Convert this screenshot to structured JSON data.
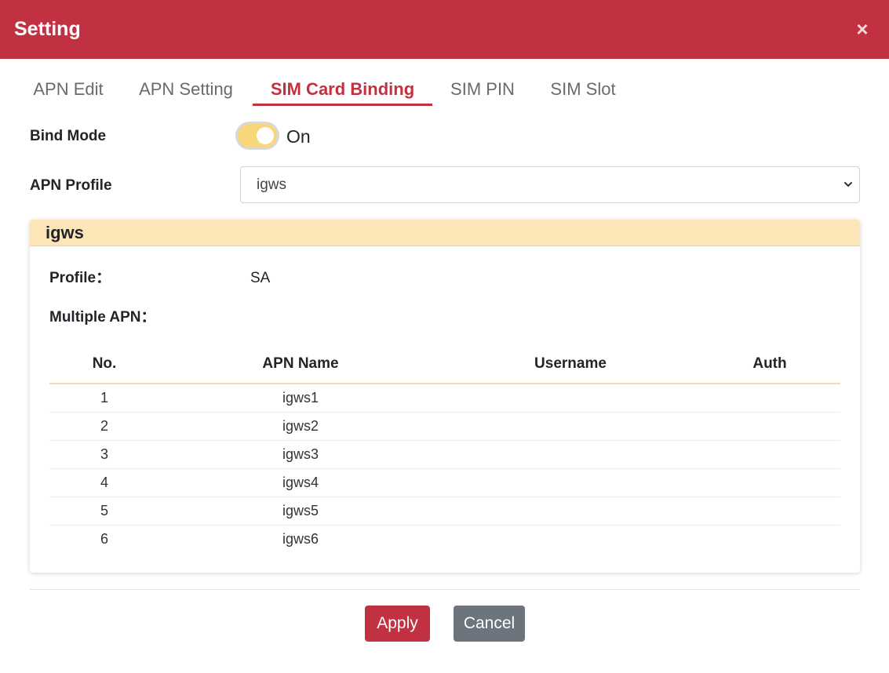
{
  "dialog": {
    "title": "Setting",
    "close_glyph": "×",
    "close_icon": "close-icon"
  },
  "tabs": [
    {
      "label": "APN Edit",
      "active": false
    },
    {
      "label": "APN Setting",
      "active": false
    },
    {
      "label": "SIM Card Binding",
      "active": true
    },
    {
      "label": "SIM PIN",
      "active": false
    },
    {
      "label": "SIM Slot",
      "active": false
    }
  ],
  "form": {
    "bind_mode_label": "Bind Mode",
    "bind_mode_state": "On",
    "bind_mode_enabled": true,
    "apn_profile_label": "APN Profile",
    "apn_profile_value": "igws"
  },
  "profile_card": {
    "title": "igws",
    "profile_label": "Profile：",
    "profile_value": "SA",
    "multiple_apn_label": "Multiple APN：",
    "table": {
      "headers": [
        "No.",
        "APN Name",
        "Username",
        "Auth"
      ],
      "rows": [
        [
          "1",
          "igws1",
          "",
          ""
        ],
        [
          "2",
          "igws2",
          "",
          ""
        ],
        [
          "3",
          "igws3",
          "",
          ""
        ],
        [
          "4",
          "igws4",
          "",
          ""
        ],
        [
          "5",
          "igws5",
          "",
          ""
        ],
        [
          "6",
          "igws6",
          "",
          ""
        ]
      ]
    }
  },
  "actions": {
    "apply_label": "Apply",
    "cancel_label": "Cancel"
  },
  "colors": {
    "brand": "#c23142",
    "toggle_on": "#f8d67a",
    "card_header": "#fce6b8",
    "cancel": "#6c757d"
  }
}
